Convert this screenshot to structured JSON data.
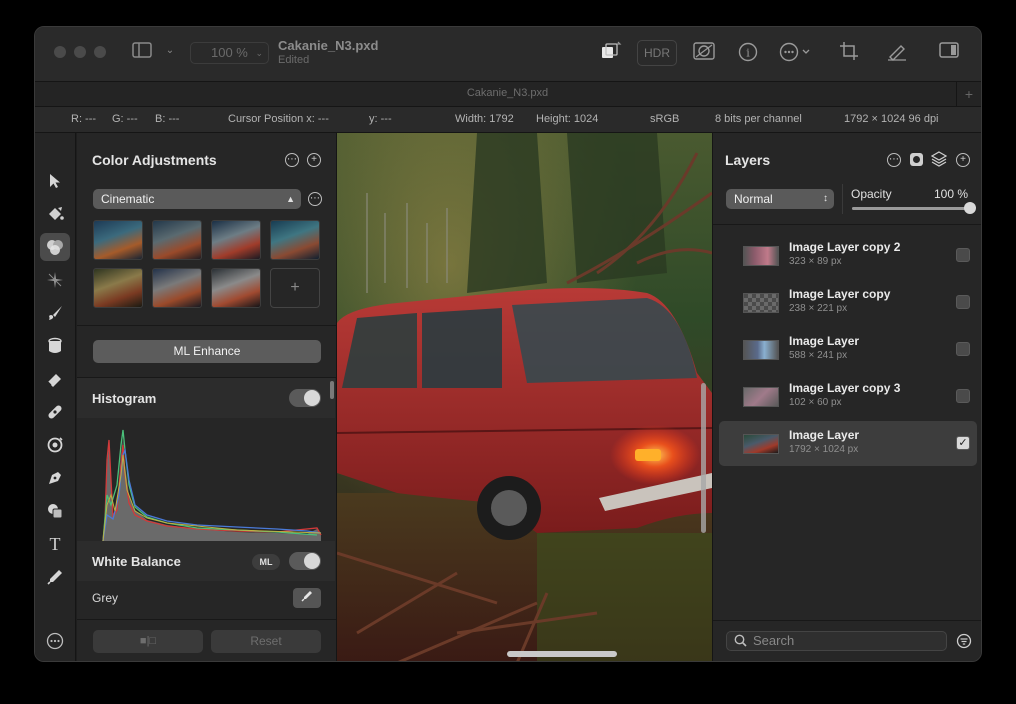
{
  "titlebar": {
    "zoom": "100 %",
    "doc_title": "Cakanie_N3.pxd",
    "doc_status": "Edited",
    "hdr_label": "HDR",
    "tab_title": "Cakanie_N3.pxd",
    "tab_add": "+"
  },
  "info": {
    "r": "R: ---",
    "g": "G: ---",
    "b": "B: ---",
    "cursor_x": "Cursor Position x: ---",
    "cursor_y": "y: ---",
    "width": "Width: 1792",
    "height": "Height: 1024",
    "color_space": "sRGB",
    "bits": "8 bits per channel",
    "resolution": "1792 × 1024 96 dpi"
  },
  "tools": [
    "arrow-tool",
    "paint-bucket-tool",
    "color-adjust-tool",
    "effects-tool",
    "brush-tool",
    "fill-tool",
    "eraser-tool",
    "repair-tool",
    "clone-tool",
    "pen-tool",
    "shape-tool",
    "text-tool",
    "picker-tool"
  ],
  "color_adjustments": {
    "title": "Color Adjustments",
    "preset_select": "Cinematic",
    "preset_add": "+",
    "ml_enhance": "ML Enhance",
    "histogram_title": "Histogram",
    "white_balance_title": "White Balance",
    "ml_badge": "ML",
    "grey_label": "Grey",
    "compare_label": "■|□",
    "reset_label": "Reset"
  },
  "layers": {
    "title": "Layers",
    "blend_mode": "Normal",
    "opacity_label": "Opacity",
    "opacity_value": "100 %",
    "opacity_fraction": 1.0,
    "items": [
      {
        "name": "Image Layer copy 2",
        "size": "323 × 89 px",
        "visible": false,
        "selected": false
      },
      {
        "name": "Image Layer copy",
        "size": "238 × 221 px",
        "visible": false,
        "selected": false
      },
      {
        "name": "Image Layer",
        "size": "588 × 241 px",
        "visible": false,
        "selected": false
      },
      {
        "name": "Image Layer copy 3",
        "size": "102 × 60 px",
        "visible": false,
        "selected": false
      },
      {
        "name": "Image Layer",
        "size": "1792 × 1024 px",
        "visible": true,
        "selected": true
      }
    ],
    "search_placeholder": "Search"
  }
}
